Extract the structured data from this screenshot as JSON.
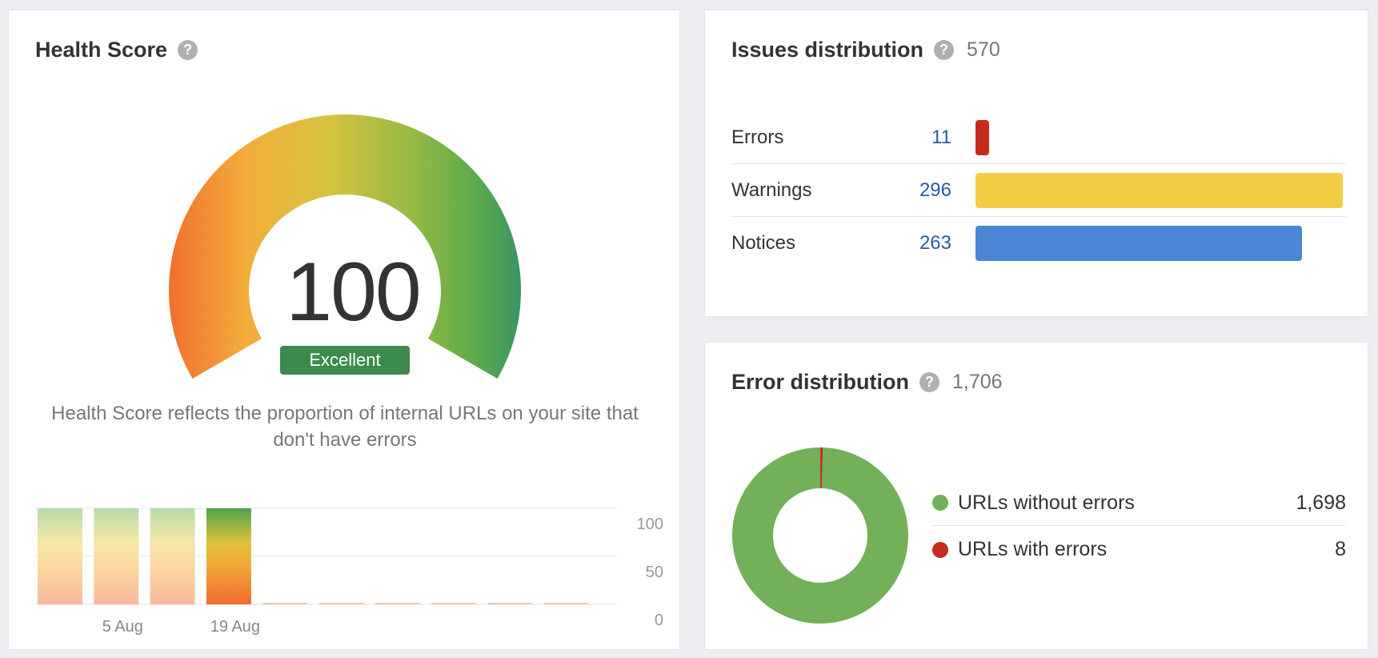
{
  "health": {
    "title": "Health Score",
    "help": "?",
    "score": "100",
    "badge": "Excellent",
    "description": "Health Score reflects the proportion of internal URLs on your site that don't have errors",
    "colors": {
      "badge": "#3d8b4c"
    }
  },
  "chart_data": [
    {
      "type": "bar",
      "categories": [
        "",
        "5 Aug",
        "",
        "19 Aug",
        "",
        "",
        "",
        "",
        "",
        ""
      ],
      "values": [
        100,
        100,
        100,
        100,
        0,
        0,
        0,
        0,
        0,
        0
      ],
      "xlabel": "",
      "ylabel": "",
      "ylim": [
        0,
        100
      ],
      "yticks": [
        "0",
        "50",
        "100"
      ],
      "grid": true,
      "current_index": 3
    },
    {
      "type": "pie",
      "categories": [
        "URLs without errors",
        "URLs with errors"
      ],
      "values": [
        1698,
        8
      ],
      "colors": [
        "#72b05a",
        "#c8291d"
      ]
    }
  ],
  "issues": {
    "title": "Issues distribution",
    "help": "?",
    "total": "570",
    "max": 296,
    "rows": [
      {
        "label": "Errors",
        "count": "11",
        "value": 11,
        "color": "#c8291d"
      },
      {
        "label": "Warnings",
        "count": "296",
        "value": 296,
        "color": "#f2cd44"
      },
      {
        "label": "Notices",
        "count": "263",
        "value": 263,
        "color": "#4a86d4"
      }
    ]
  },
  "errors": {
    "title": "Error distribution",
    "help": "?",
    "total": "1,706",
    "legend": [
      {
        "label": "URLs without errors",
        "value": "1,698",
        "color": "#72b05a"
      },
      {
        "label": "URLs with errors",
        "value": "8",
        "color": "#c8291d"
      }
    ]
  }
}
